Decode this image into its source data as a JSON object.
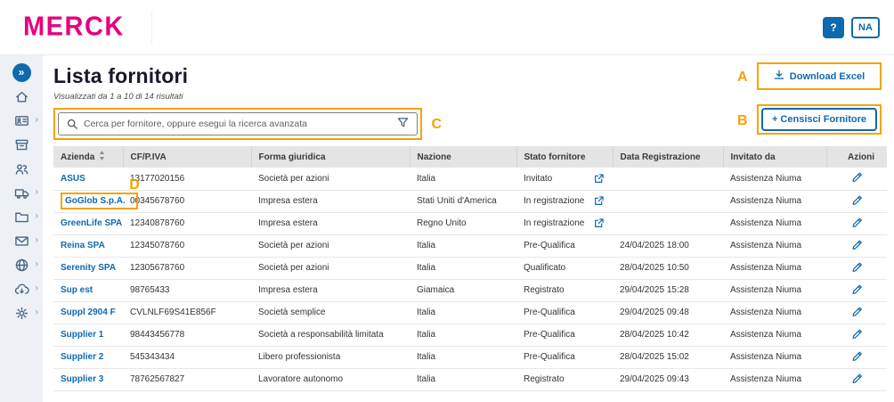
{
  "colors": {
    "brand_magenta": "#E6007E",
    "primary_blue": "#0F69AF",
    "annotation_orange": "#F5A300",
    "sidebar_bg": "#EDF1F6"
  },
  "topbar": {
    "logo": "MERCK",
    "help_label": "?",
    "user_initials": "NA"
  },
  "sidebar": {
    "items": [
      {
        "icon": "chevrons-right-icon",
        "active": true
      },
      {
        "icon": "home-icon"
      },
      {
        "icon": "id-card-icon",
        "chevron": true
      },
      {
        "icon": "archive-icon"
      },
      {
        "icon": "users-icon"
      },
      {
        "icon": "truck-icon",
        "chevron": true
      },
      {
        "icon": "folder-icon",
        "chevron": true
      },
      {
        "icon": "mail-icon",
        "chevron": true
      },
      {
        "icon": "globe-icon",
        "chevron": true
      },
      {
        "icon": "cloud-download-icon",
        "chevron": true
      },
      {
        "icon": "gear-icon",
        "chevron": true
      }
    ]
  },
  "page": {
    "title": "Lista fornitori",
    "results_summary": "Visualizzati da 1 a 10 di 14 risultati"
  },
  "search": {
    "placeholder": "Cerca per fornitore, oppure esegui la ricerca avanzata"
  },
  "toolbar": {
    "download_excel_label": "Download Excel",
    "censisci_label": "+ Censisci Fornitore"
  },
  "annotations": {
    "a": "A",
    "b": "B",
    "c": "C",
    "d": "D"
  },
  "table": {
    "headers": [
      "Azienda",
      "CF/P.IVA",
      "Forma giuridica",
      "Nazione",
      "Stato fornitore",
      "Data Registrazione",
      "Invitato da",
      "Azioni"
    ],
    "rows": [
      {
        "azienda": "ASUS",
        "cf_piva": "13177020156",
        "forma_giuridica": "Società per azioni",
        "nazione": "Italia",
        "stato_fornitore": "Invitato",
        "external_link": true,
        "data_registrazione": "",
        "invitato_da": "Assistenza Niuma"
      },
      {
        "azienda": "GoGlob S.p.A.",
        "cf_piva": "00345678760",
        "forma_giuridica": "Impresa estera",
        "nazione": "Stati Uniti d'America",
        "stato_fornitore": "In registrazione",
        "external_link": true,
        "data_registrazione": "",
        "invitato_da": "Assistenza Niuma",
        "annotated": true
      },
      {
        "azienda": "GreenLife SPA",
        "cf_piva": "12340878760",
        "forma_giuridica": "Impresa estera",
        "nazione": "Regno Unito",
        "stato_fornitore": "In registrazione",
        "external_link": true,
        "data_registrazione": "",
        "invitato_da": "Assistenza Niuma"
      },
      {
        "azienda": "Reina SPA",
        "cf_piva": "12345078760",
        "forma_giuridica": "Società per azioni",
        "nazione": "Italia",
        "stato_fornitore": "Pre-Qualifica",
        "external_link": false,
        "data_registrazione": "24/04/2025 18:00",
        "invitato_da": "Assistenza Niuma"
      },
      {
        "azienda": "Serenity SPA",
        "cf_piva": "12305678760",
        "forma_giuridica": "Società per azioni",
        "nazione": "Italia",
        "stato_fornitore": "Qualificato",
        "external_link": false,
        "data_registrazione": "28/04/2025 10:50",
        "invitato_da": "Assistenza Niuma"
      },
      {
        "azienda": "Sup est",
        "cf_piva": "98765433",
        "forma_giuridica": "Impresa estera",
        "nazione": "Giamaica",
        "stato_fornitore": "Registrato",
        "external_link": false,
        "data_registrazione": "29/04/2025 15:28",
        "invitato_da": "Assistenza Niuma"
      },
      {
        "azienda": "Suppl 2904 F",
        "cf_piva": "CVLNLF69S41E856F",
        "forma_giuridica": "Società semplice",
        "nazione": "Italia",
        "stato_fornitore": "Pre-Qualifica",
        "external_link": false,
        "data_registrazione": "29/04/2025 09:48",
        "invitato_da": "Assistenza Niuma"
      },
      {
        "azienda": "Supplier 1",
        "cf_piva": "98443456778",
        "forma_giuridica": "Società a responsabilità limitata",
        "nazione": "Italia",
        "stato_fornitore": "Pre-Qualifica",
        "external_link": false,
        "data_registrazione": "28/04/2025 10:42",
        "invitato_da": "Assistenza Niuma"
      },
      {
        "azienda": "Supplier 2",
        "cf_piva": "545343434",
        "forma_giuridica": "Libero professionista",
        "nazione": "Italia",
        "stato_fornitore": "Pre-Qualifica",
        "external_link": false,
        "data_registrazione": "28/04/2025 15:02",
        "invitato_da": "Assistenza Niuma"
      },
      {
        "azienda": "Supplier 3",
        "cf_piva": "78762567827",
        "forma_giuridica": "Lavoratore autonomo",
        "nazione": "Italia",
        "stato_fornitore": "Registrato",
        "external_link": false,
        "data_registrazione": "29/04/2025 09:43",
        "invitato_da": "Assistenza Niuma"
      }
    ]
  }
}
